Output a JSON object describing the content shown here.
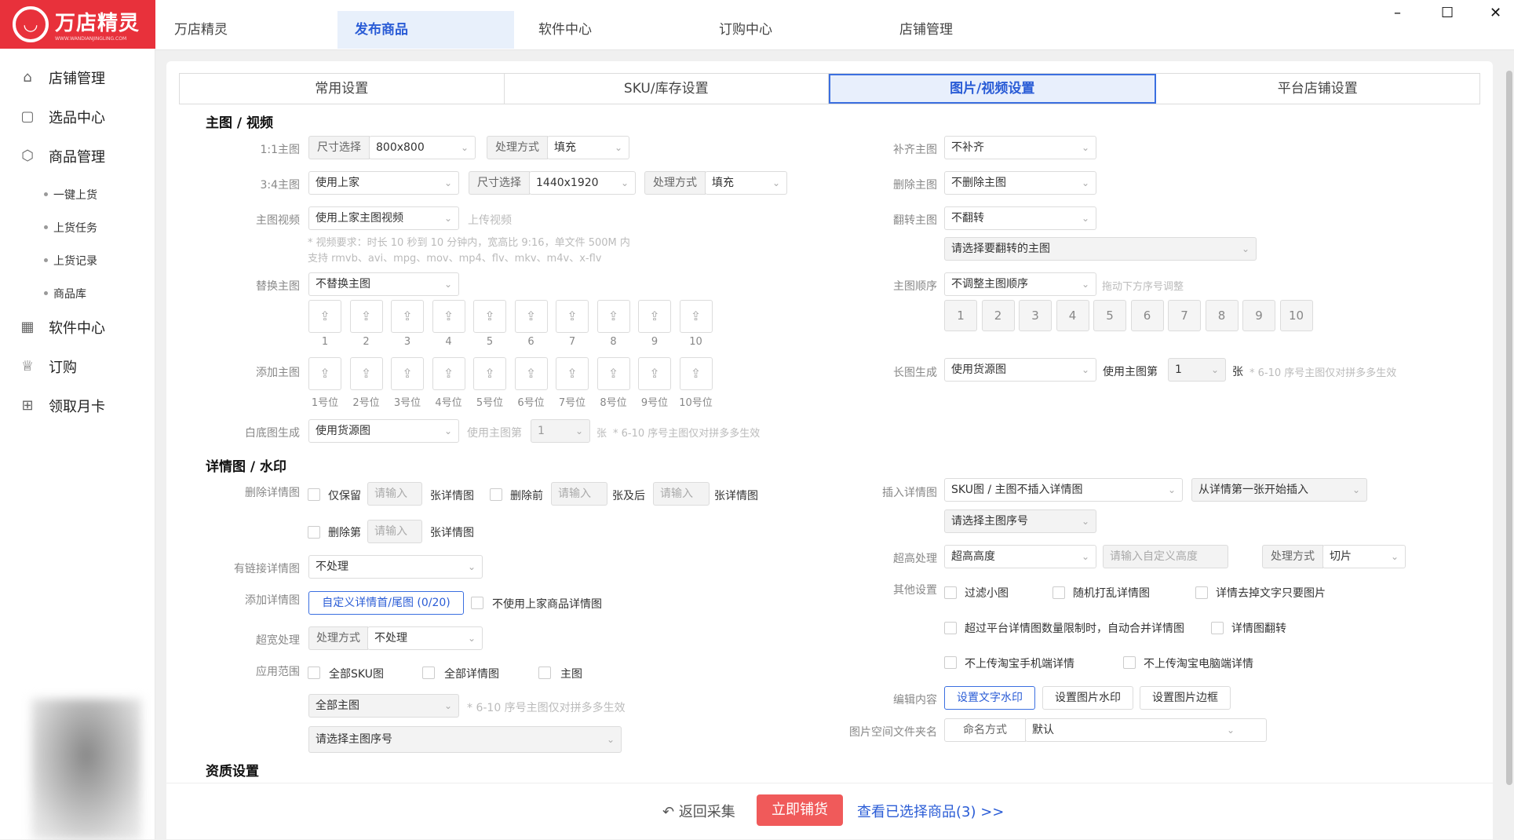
{
  "app": {
    "logo_text": "万店精灵",
    "logo_sub": "WWW.WANDIANJINGLING.COM"
  },
  "top_tabs": [
    "万店精灵",
    "发布商品",
    "软件中心",
    "订购中心",
    "店铺管理"
  ],
  "window": {
    "minimize": "–",
    "maximize": "☐",
    "close": "✕"
  },
  "sidebar": {
    "items": [
      "店铺管理",
      "选品中心",
      "商品管理",
      "软件中心",
      "订购",
      "领取月卡"
    ],
    "sub": [
      "一键上货",
      "上货任务",
      "上货记录",
      "商品库"
    ]
  },
  "settings_tabs": [
    "常用设置",
    "SKU/库存设置",
    "图片/视频设置",
    "平台店铺设置"
  ],
  "sec_main": "主图 / 视频",
  "sec_detail": "详情图 / 水印",
  "sec_qual": "资质设置",
  "l": {
    "r11": "1:1主图",
    "r34": "3:4主图",
    "video": "主图视频",
    "replace": "替换主图",
    "add": "添加主图",
    "white": "白底图生成",
    "fill": "补齐主图",
    "del": "删除主图",
    "flip": "翻转主图",
    "order": "主图顺序",
    "long": "长图生成",
    "deldet": "删除详情图",
    "link": "有链接详情图",
    "adddet": "添加详情图",
    "wide": "超宽处理",
    "scope": "应用范围",
    "insert": "插入详情图",
    "tall": "超高处理",
    "other": "其他设置",
    "edit": "编辑内容",
    "folder": "图片空间文件夹名"
  },
  "v": {
    "size_sel": "尺寸选择",
    "s800": "800x800",
    "proc": "处理方式",
    "fill": "填充",
    "use_sup": "使用上家",
    "s1440": "1440x1920",
    "use_sup_video": "使用上家主图视频",
    "upload_video": "上传视频",
    "video_hint1": "* 视频要求：时长 10 秒到 10 分钟内，宽高比 9:16，单文件 500M 内",
    "video_hint2": "支持 rmvb、avi、mpg、mov、mp4、flv、mkv、m4v、x-flv",
    "no_replace": "不替换主图",
    "use_src": "使用货源图",
    "use_main_n": "使用主图第",
    "one": "1",
    "zhang": "张",
    "hint610": "* 6-10 序号主图仅对拼多多生效",
    "no_fill": "不补齐",
    "no_del": "不删除主图",
    "no_flip": "不翻转",
    "pick_flip": "请选择要翻转的主图",
    "no_adjust": "不调整主图顺序",
    "drag_hint": "拖动下方序号调整",
    "only_keep": "仅保留",
    "ph": "请输入",
    "det_unit": "张详情图",
    "del_front": "删除前",
    "zhang_after": "张及后",
    "del_nth": "删除第",
    "no_proc": "不处理",
    "custom_head": "自定义详情首/尾图 (0/20)",
    "no_use_sup_det": "不使用上家商品详情图",
    "all_sku": "全部SKU图",
    "all_det": "全部详情图",
    "main": "主图",
    "all_main": "全部主图",
    "pick_main_no": "请选择主图序号",
    "ins_sel": "SKU图 / 主图不插入详情图",
    "ins_from": "从详情第一张开始插入",
    "over_h": "超高高度",
    "ph_h": "请输入自定义高度",
    "cut": "切片",
    "f_small": "过滤小图",
    "rand": "随机打乱详情图",
    "only_pic": "详情去掉文字只要图片",
    "merge": "超过平台详情图数量限制时，自动合并详情图",
    "flip_det": "详情图翻转",
    "no_mobile": "不上传淘宝手机端详情",
    "no_pc": "不上传淘宝电脑端详情",
    "wm_text": "设置文字水印",
    "wm_pic": "设置图片水印",
    "border": "设置图片边框",
    "name_mode": "命名方式",
    "default": "默认"
  },
  "nums": [
    "1",
    "2",
    "3",
    "4",
    "5",
    "6",
    "7",
    "8",
    "9",
    "10"
  ],
  "pos": [
    "1号位",
    "2号位",
    "3号位",
    "4号位",
    "5号位",
    "6号位",
    "7号位",
    "8号位",
    "9号位",
    "10号位"
  ],
  "footer": {
    "back": "返回采集",
    "go": "立即铺货",
    "view": "查看已选择商品(3) >>"
  }
}
